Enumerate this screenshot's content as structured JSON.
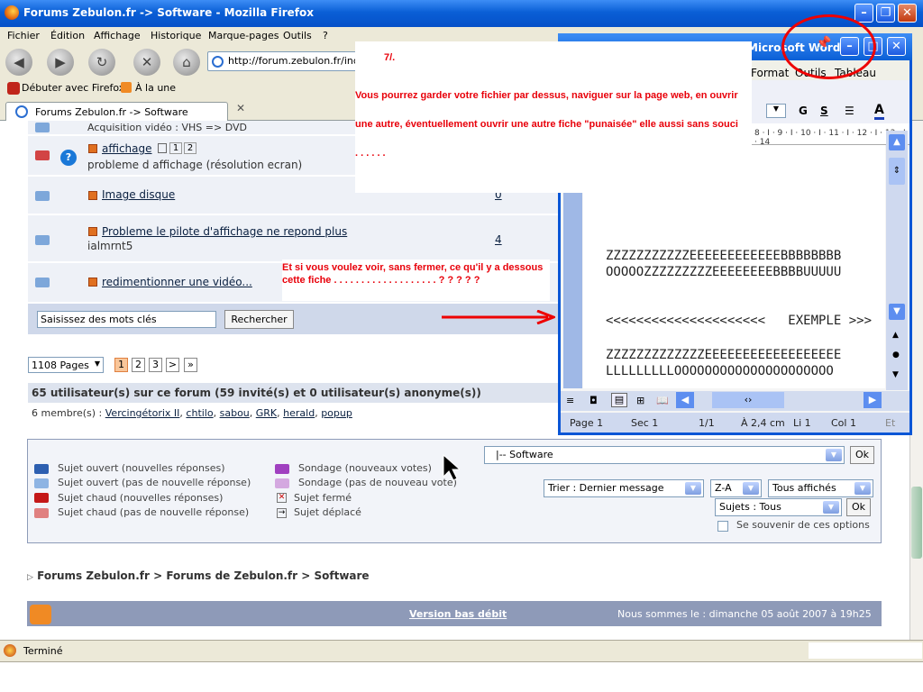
{
  "window": {
    "title": "Forums Zebulon.fr -> Software - Mozilla Firefox"
  },
  "menu": [
    "Fichier",
    "Édition",
    "Affichage",
    "Historique",
    "Marque-pages",
    "Outils",
    "?"
  ],
  "url": "http://forum.zebulon.fr/index",
  "bookmarks": [
    "Débuter avec Firefox",
    "À la une"
  ],
  "tab": {
    "label": "Forums Zebulon.fr -> Software"
  },
  "topics": [
    {
      "title": "",
      "desc": "Acquisition vidéo : VHS => DVD",
      "pages": []
    },
    {
      "title": "affichage",
      "desc": "probleme d affichage (résolution ecran)",
      "pages": [
        "1",
        "2"
      ],
      "hot": true
    },
    {
      "title": "Image disque",
      "desc": "",
      "replies": "0"
    },
    {
      "title": "Probleme le pilote d'affichage ne repond plus",
      "desc": "ialmrnt5",
      "replies": "4"
    },
    {
      "title": "redimentionner une vidéo...",
      "desc": "",
      "replies": ""
    }
  ],
  "search": {
    "placeholder": "Saisissez des mots clés",
    "button": "Rechercher"
  },
  "pagination": {
    "select": "1108 Pages",
    "pages": [
      "1",
      "2",
      "3",
      ">",
      "»"
    ]
  },
  "users": {
    "summary": "65 utilisateur(s) sur ce forum (59 invité(s) et 0 utilisateur(s) anonyme(s))",
    "members_label": "6 membre(s) :",
    "members": [
      "Vercingétorix II",
      "chtilo",
      "sabou",
      "GRK",
      "herald",
      "popup"
    ]
  },
  "legend": {
    "left": [
      "Sujet ouvert (nouvelles réponses)",
      "Sujet ouvert (pas de nouvelle réponse)",
      "Sujet chaud (nouvelles réponses)",
      "Sujet chaud (pas de nouvelle réponse)"
    ],
    "right": [
      "Sondage (nouveaux votes)",
      "Sondage (pas de nouveau vote)",
      "Sujet fermé",
      "Sujet déplacé"
    ]
  },
  "controls": {
    "forum_select": "|-- Software",
    "ok": "Ok",
    "sort": "Trier : Dernier message",
    "order": "Z-A",
    "show": "Tous affichés",
    "subjects": "Sujets : Tous",
    "remember": "Se souvenir de ces options"
  },
  "breadcrumb": [
    "Forums Zebulon.fr",
    "Forums de Zebulon.fr",
    "Software"
  ],
  "footer": {
    "lowbw": "Version bas débit",
    "date": "Nous sommes le : dimanche 05 août 2007 à 19h25"
  },
  "status": "Terminé",
  "word": {
    "title": "Microsoft Word",
    "menu": [
      "Format",
      "Outils",
      "Tableau"
    ],
    "ruler": "8 · I · 9 · I · 10 · I · 11 · I · 12 · I · 13 · I · 14",
    "lines": [
      "ZZZZZZZZZZZEEEEEEEEEEEEBBBBBBBB",
      "OOOOOZZZZZZZZZEEEEEEEEBBBBUUUUU",
      "<<<<<<<<<<<<<<<<<<<<<   EXEMPLE >>>",
      "ZZZZZZZZZZZZZEEEEEEEEEEEEEEEEEE",
      "LLLLLLLLLOOOOOOOOOOOOOOOOOOOOO"
    ],
    "status": [
      "Page 1",
      "Sec 1",
      "1/1",
      "À 2,4 cm",
      "Li 1",
      "Col 1",
      "Et"
    ]
  },
  "notes": {
    "step": "7/.",
    "main": "Vous pourrez garder votre fichier par dessus, naviguer sur la page web, en ouvrir une autre, éventuellement ouvrir une autre fiche \"punaisée\" elle aussi sans souci . . . . . .",
    "side": "Et si vous voulez voir, sans fermer, ce qu'il y a dessous cette fiche . . . . . . . . . . . . . . . . . . .        ? ? ? ? ?"
  },
  "colors": {
    "title_blue": "#0a5fd6",
    "annotation_red": "#e8000a",
    "forum_bar": "#8e9ab8"
  }
}
